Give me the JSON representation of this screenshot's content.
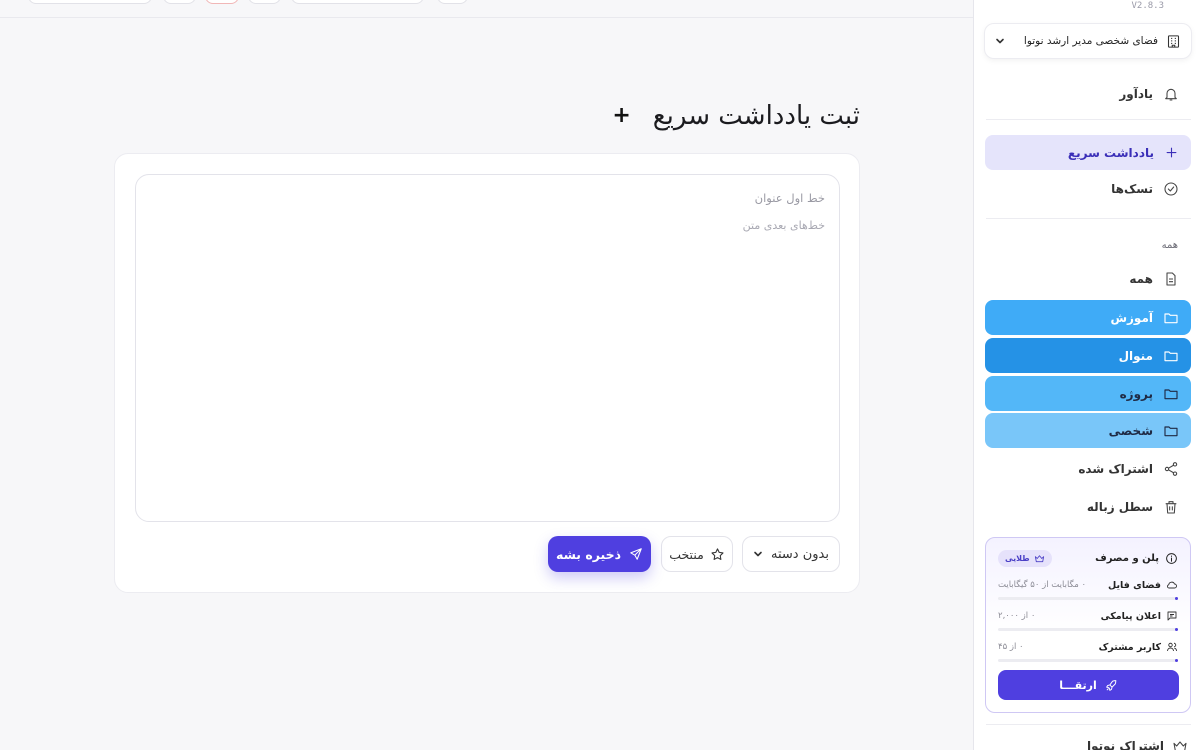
{
  "app": {
    "version": "V2.8.3"
  },
  "workspace": {
    "label": "فضای شخصی مدیر ارشد نوتوا",
    "icon": "building-icon"
  },
  "sidebar": {
    "reminder_label": "یادآور",
    "quick_note_label": "یادداشت سریع",
    "tasks_label": "تسک‌ها",
    "section_all_label": "همه",
    "all_label": "همه",
    "folders": [
      {
        "label": "آموزش",
        "color": "#3fabf7"
      },
      {
        "label": "منوال",
        "color": "#2592e6"
      },
      {
        "label": "پروژه",
        "color": "#53b7f8"
      },
      {
        "label": "شخصی",
        "color": "#79c6f9"
      }
    ],
    "shared_label": "اشتراک شده",
    "trash_label": "سطل زباله",
    "bottom_label": "اشتراک نوتوا"
  },
  "plan": {
    "title": "پلن و مصرف",
    "badge": "طلایی",
    "usage": [
      {
        "name": "فضای فایل",
        "value": "۰ مگابایت از ۵۰ گیگابایت",
        "fraction": 0.01,
        "icon": "cloud-icon"
      },
      {
        "name": "اعلان پیامکی",
        "value": "۰ از ۲,۰۰۰",
        "fraction": 0.01,
        "icon": "message-icon"
      },
      {
        "name": "کاربر مشترک",
        "value": "۰ از ۴۵",
        "fraction": 0.01,
        "icon": "users-icon"
      }
    ],
    "upgrade_label": "ارتقـــا"
  },
  "main": {
    "title": "ثبت یادداشت سریع",
    "editor": {
      "title_placeholder": "خط اول عنوان",
      "body_placeholder": "خط‌های بعدی متن"
    },
    "category_label": "بدون دسته",
    "favorite_label": "منتخب",
    "save_label": "ذخیره بشه"
  },
  "colors": {
    "accent": "#4f3fe0",
    "active_nav_bg": "#e5e4fb"
  }
}
